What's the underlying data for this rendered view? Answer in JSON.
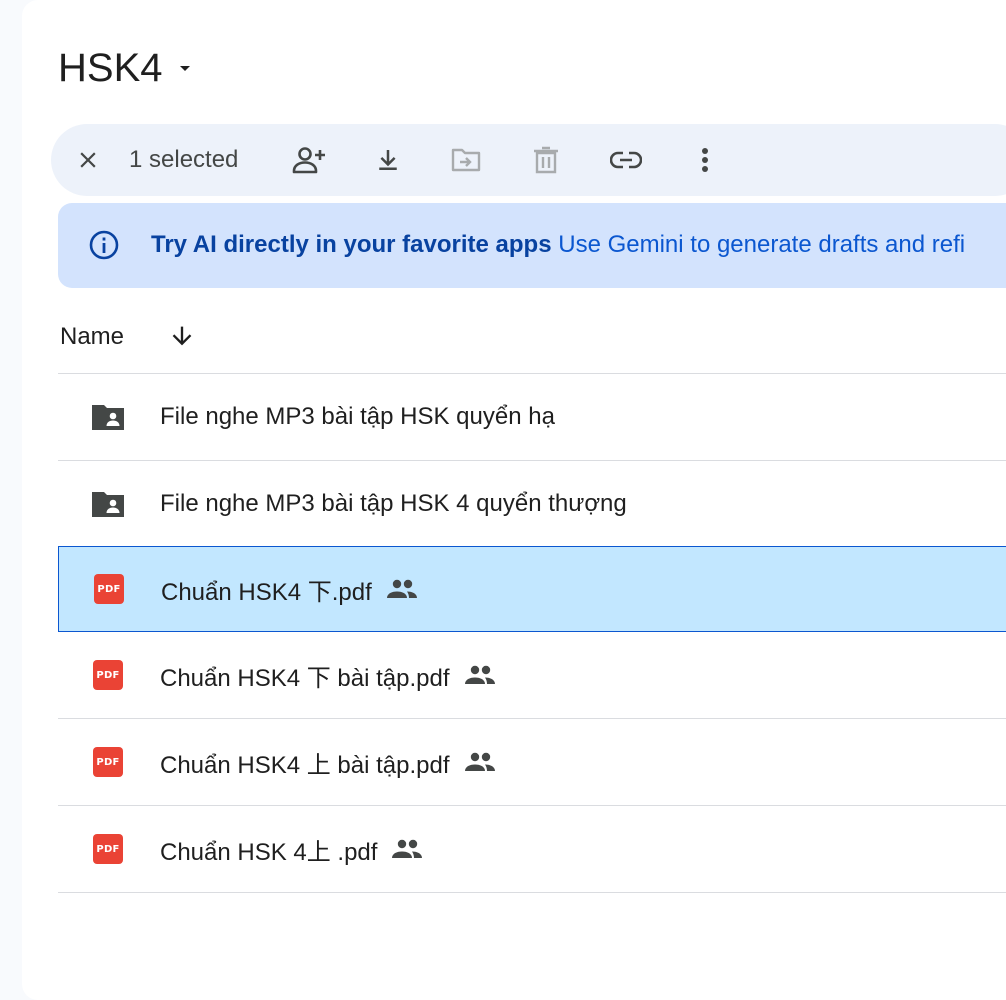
{
  "folder": {
    "title": "HSK4"
  },
  "selection_bar": {
    "count_label": "1 selected",
    "actions": [
      "close-icon",
      "share-icon",
      "download-icon",
      "move-icon",
      "trash-icon",
      "link-icon",
      "more-icon"
    ]
  },
  "banner": {
    "bold_text": "Try AI directly in your favorite apps",
    "text": "Use Gemini to generate drafts and refi"
  },
  "list": {
    "column_name": "Name",
    "items": [
      {
        "name": "File nghe MP3 bài tập HSK quyển hạ",
        "type": "shared-folder",
        "shared": false,
        "selected": false
      },
      {
        "name": "File nghe MP3 bài tập HSK 4 quyển thượng",
        "type": "shared-folder",
        "shared": false,
        "selected": false
      },
      {
        "name": "Chuẩn HSK4 下.pdf",
        "type": "pdf",
        "shared": true,
        "selected": true
      },
      {
        "name": "Chuẩn HSK4 下 bài tập.pdf",
        "type": "pdf",
        "shared": true,
        "selected": false
      },
      {
        "name": "Chuẩn HSK4 上 bài tập.pdf",
        "type": "pdf",
        "shared": true,
        "selected": false
      },
      {
        "name": "Chuẩn HSK 4上 .pdf",
        "type": "pdf",
        "shared": true,
        "selected": false
      }
    ]
  },
  "pdf_badge_label": "PDF",
  "colors": {
    "accent": "#0b57d0",
    "selected_row": "#c2e7ff",
    "banner": "#d3e3fd",
    "pdf": "#ea4335"
  }
}
